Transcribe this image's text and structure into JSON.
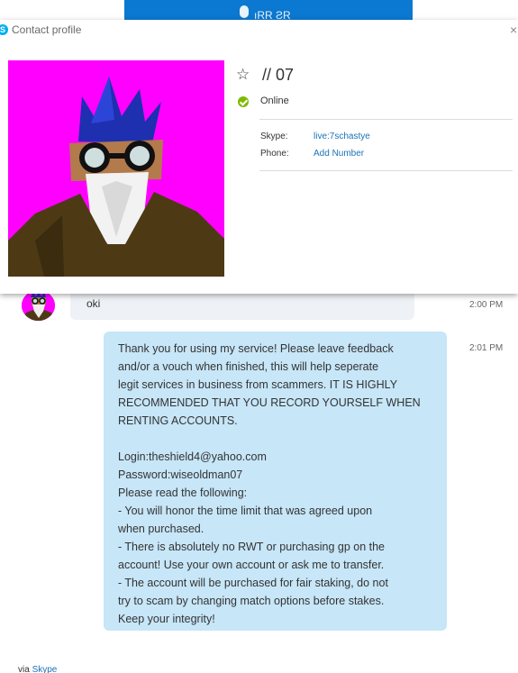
{
  "banner": {
    "text": "ıRR ƧR"
  },
  "popup": {
    "title": "Contact profile",
    "close_glyph": "×",
    "contact": {
      "name": "// 07",
      "status": "Online",
      "skype_label": "Skype:",
      "skype_value": "live:7schastye",
      "phone_label": "Phone:",
      "phone_value": "Add Number"
    }
  },
  "messages": [
    {
      "text": "oki",
      "time": "2:00 PM"
    },
    {
      "text": "Thank you for using my service! Please leave feedback\nand/or a vouch when finished, this will help seperate\nlegit services in business from scammers. IT IS HIGHLY\nRECOMMENDED THAT YOU RECORD YOURSELF WHEN\nRENTING ACCOUNTS.\n\nLogin:theshield4@yahoo.com\nPassword:wiseoldman07\nPlease read the following:\n- You will honor the time limit that was agreed upon\nwhen purchased.\n- There is absolutely no RWT or purchasing gp on the\naccount! Use your own account or ask me to transfer.\n- The account will be purchased for fair staking, do not\ntry to scam by changing match options before stakes.\nKeep your integrity!",
      "time": "2:01 PM"
    }
  ],
  "footer": {
    "prefix": "via",
    "link": "Skype"
  },
  "colors": {
    "accent": "#1a73b8",
    "online": "#7fba00",
    "avatar_bg": "#ff00ff",
    "outgoing_bubble": "#c7e6f8",
    "incoming_bubble": "#eef1f5"
  },
  "icons": {
    "star": "star-outline-icon",
    "close": "close-icon",
    "status": "online-check-icon",
    "logo": "skype-logo-icon"
  }
}
